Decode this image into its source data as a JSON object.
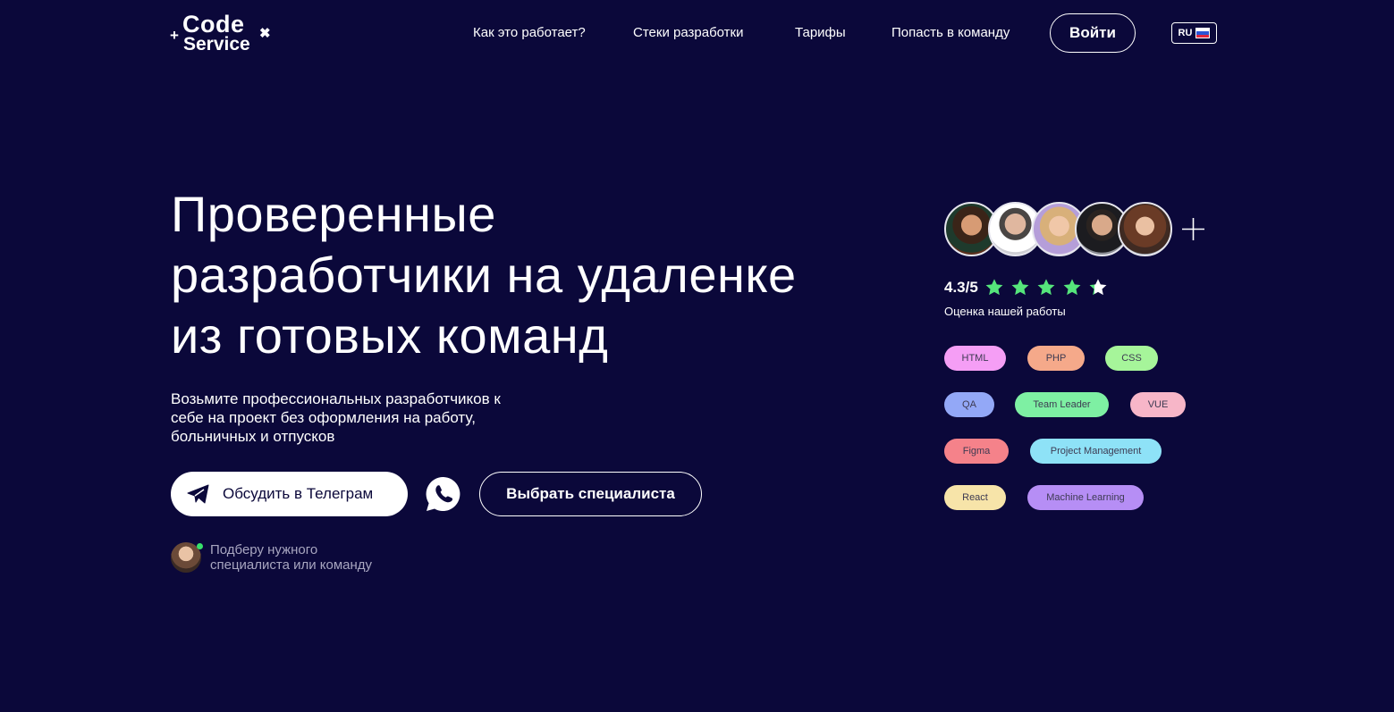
{
  "logo": {
    "line1": "Code",
    "line2": "Service"
  },
  "nav": {
    "items": [
      {
        "label": "Как это работает?"
      },
      {
        "label": "Стеки разработки"
      },
      {
        "label": "Тарифы"
      },
      {
        "label": "Попасть в команду"
      }
    ],
    "login_label": "Войти",
    "lang_label": "RU"
  },
  "hero": {
    "title_lines": [
      "Проверенные",
      "разработчики на удаленке",
      "из готовых команд"
    ],
    "subtitle_lines": [
      "Возьмите профессиональных разработчиков к",
      "себе на проект без оформления на работу,",
      "больничных и отпусков"
    ],
    "telegram_button": "Обсудить в Телеграм",
    "choose_button": "Выбрать специалиста",
    "manager_lines": [
      "Подберу нужного",
      "специалиста или команду"
    ]
  },
  "team": {
    "rating": "4.3/5",
    "stars": 5,
    "rating_label": "Оценка нашей работы"
  },
  "tags": [
    {
      "label": "HTML",
      "color": "#f59ef5"
    },
    {
      "label": "PHP",
      "color": "#f5a98a"
    },
    {
      "label": "CSS",
      "color": "#a6f59a"
    },
    {
      "label": "QA",
      "color": "#93a8f7"
    },
    {
      "label": "Team Leader",
      "color": "#7ef0a3"
    },
    {
      "label": "VUE",
      "color": "#f7b6c8"
    },
    {
      "label": "Figma",
      "color": "#f5828a"
    },
    {
      "label": "Project Management",
      "color": "#8ee2f7"
    },
    {
      "label": "React",
      "color": "#f7e4a9"
    },
    {
      "label": "Machine Learning",
      "color": "#b68ef5"
    }
  ],
  "colors": {
    "background": "#0b083a",
    "star": "#55e57b",
    "online": "#37e06a"
  }
}
